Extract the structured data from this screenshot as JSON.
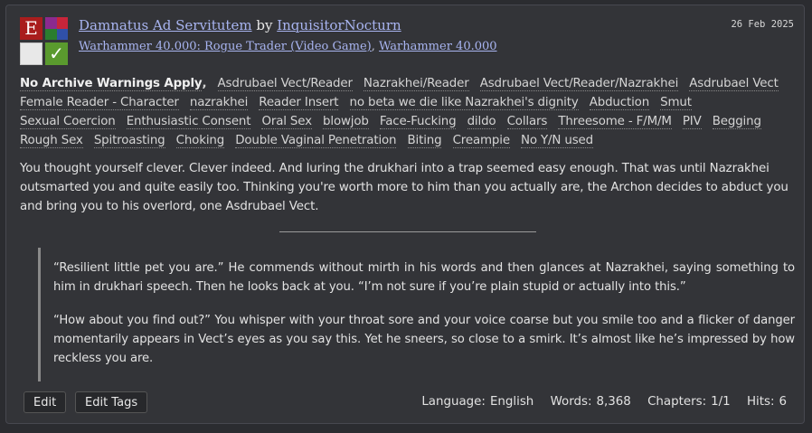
{
  "work": {
    "title": "Damnatus Ad Servitutem",
    "by": "by",
    "author": "InquisitorNocturn",
    "fandoms": [
      "Warhammer 40.000: Rogue Trader (Video Game)",
      "Warhammer 40.000"
    ],
    "fandom_sep": ",",
    "date": "26 Feb 2025"
  },
  "symbols": {
    "rating_letter": "E",
    "rating_color": "#a91d1d",
    "category_colors": [
      "#8b2a8f",
      "#c8253a",
      "#2a7d2e",
      "#3050a8"
    ],
    "warnings": "blank",
    "complete_glyph": "✓",
    "complete_color": "#5a9a2e"
  },
  "tags": [
    "No Archive Warnings Apply",
    "Asdrubael Vect/Reader",
    "Nazrakhei/Reader",
    "Asdrubael Vect/Reader/Nazrakhei",
    "Asdrubael Vect",
    "Female Reader - Character",
    "nazrakhei",
    "Reader Insert",
    "no beta we die like Nazrakhei's dignity",
    "Abduction",
    "Smut",
    "Sexual Coercion",
    "Enthusiastic Consent",
    "Oral Sex",
    "blowjob",
    "Face-Fucking",
    "dildo",
    "Collars",
    "Threesome - F/M/M",
    "PIV",
    "Begging",
    "Rough Sex",
    "Spitroasting",
    "Choking",
    "Double Vaginal Penetration",
    "Biting",
    "Creampie",
    "No Y/N used"
  ],
  "summary": "You thought yourself clever. Clever indeed. And luring the drukhari into a trap seemed easy enough. That was until Nazrakhei outsmarted you and quite easily too. Thinking you're worth more to him than you actually are, the Archon decides to abduct you and bring you to his overlord, one Asdrubael Vect.",
  "quote": [
    "“Resilient little pet you are.” He commends without mirth in his words and then glances at Nazrakhei, saying something to him in drukhari speech. Then he looks back at you. “I’m not sure if you’re plain stupid or actually into this.”",
    "“How about you find out?” You whisper with your throat sore and your voice coarse but you smile too and a flicker of danger momentarily appears in Vect’s eyes as you say this. Yet he sneers, so close to a smirk. It’s almost like he’s impressed by how reckless you are."
  ],
  "actions": {
    "edit": "Edit",
    "edit_tags": "Edit Tags"
  },
  "stats": {
    "language_label": "Language:",
    "language": "English",
    "words_label": "Words:",
    "words": "8,368",
    "chapters_label": "Chapters:",
    "chapters": "1/1",
    "hits_label": "Hits:",
    "hits": "6"
  }
}
